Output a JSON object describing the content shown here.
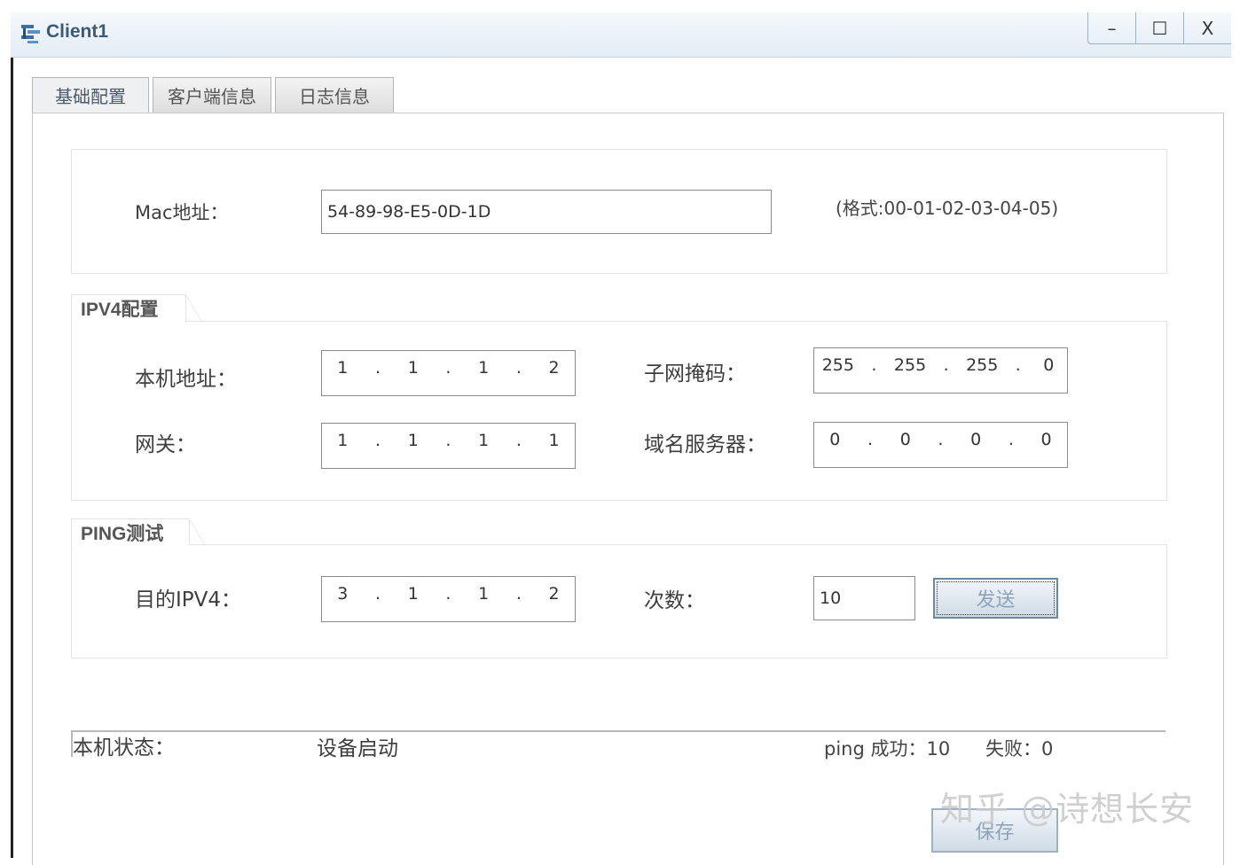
{
  "window": {
    "title": "Client1",
    "minimize": "–",
    "maximize": "☐",
    "close": "X"
  },
  "tabs": [
    {
      "label": "基础配置",
      "active": true
    },
    {
      "label": "客户端信息",
      "active": false
    },
    {
      "label": "日志信息",
      "active": false
    }
  ],
  "mac": {
    "label": "Mac地址：",
    "value": "54-89-98-E5-0D-1D",
    "format_hint": "(格式:00-01-02-03-04-05)"
  },
  "ipv4": {
    "legend": "IPV4配置",
    "local_label": "本机地址：",
    "local": [
      "1",
      "1",
      "1",
      "2"
    ],
    "mask_label": "子网掩码：",
    "mask": [
      "255",
      "255",
      "255",
      "0"
    ],
    "gateway_label": "网关：",
    "gateway": [
      "1",
      "1",
      "1",
      "1"
    ],
    "dns_label": "域名服务器：",
    "dns": [
      "0",
      "0",
      "0",
      "0"
    ]
  },
  "ping": {
    "legend": "PING测试",
    "dest_label": "目的IPV4：",
    "dest": [
      "3",
      "1",
      "1",
      "2"
    ],
    "count_label": "次数：",
    "count": "10",
    "send_label": "发送"
  },
  "status": {
    "label": "本机状态：",
    "value": "设备启动",
    "ping_result": "ping 成功：10",
    "fail_result": "失败：0"
  },
  "save_label": "保存",
  "watermark": "知乎 @诗想长安",
  "colors": {
    "title_text": "#3b5a78",
    "button_border": "#6d88a3",
    "button_text": "#8da3b8"
  }
}
